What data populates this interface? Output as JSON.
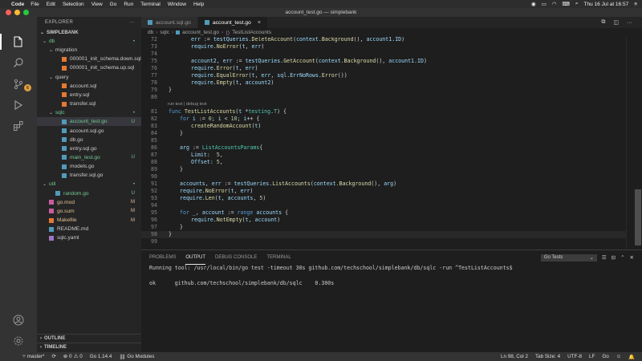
{
  "menubar": {
    "app": "Code",
    "items": [
      "File",
      "Edit",
      "Selection",
      "View",
      "Go",
      "Run",
      "Terminal",
      "Window",
      "Help"
    ],
    "datetime": "Thu 16 Jul at 16:57"
  },
  "window": {
    "title": "account_test.go — simplebank"
  },
  "sidebar": {
    "header": "EXPLORER",
    "project": "SIMPLEBANK",
    "tree": [
      {
        "label": "db",
        "depth": 0,
        "chev": "v",
        "type": "folder",
        "color": "green",
        "status": "•"
      },
      {
        "label": "migration",
        "depth": 1,
        "chev": "v",
        "type": "folder"
      },
      {
        "label": "000001_init_schema.down.sql",
        "depth": 2,
        "type": "sql"
      },
      {
        "label": "000001_init_schema.up.sql",
        "depth": 2,
        "type": "sql"
      },
      {
        "label": "query",
        "depth": 1,
        "chev": "v",
        "type": "folder"
      },
      {
        "label": "account.sql",
        "depth": 2,
        "type": "sql"
      },
      {
        "label": "entry.sql",
        "depth": 2,
        "type": "sql"
      },
      {
        "label": "transfer.sql",
        "depth": 2,
        "type": "sql"
      },
      {
        "label": "sqlc",
        "depth": 1,
        "chev": "v",
        "type": "folder",
        "color": "green",
        "status": "•"
      },
      {
        "label": "account_test.go",
        "depth": 2,
        "type": "go",
        "color": "green",
        "status": "U",
        "selected": true
      },
      {
        "label": "account.sql.go",
        "depth": 2,
        "type": "go"
      },
      {
        "label": "db.go",
        "depth": 2,
        "type": "go"
      },
      {
        "label": "entry.sql.go",
        "depth": 2,
        "type": "go"
      },
      {
        "label": "main_test.go",
        "depth": 2,
        "type": "go",
        "color": "green",
        "status": "U"
      },
      {
        "label": "models.go",
        "depth": 2,
        "type": "go"
      },
      {
        "label": "transfer.sql.go",
        "depth": 2,
        "type": "go"
      },
      {
        "label": "util",
        "depth": 0,
        "chev": "v",
        "type": "folder",
        "color": "green",
        "status": "•"
      },
      {
        "label": "random.go",
        "depth": 1,
        "type": "go",
        "color": "green",
        "status": "U"
      },
      {
        "label": "go.mod",
        "depth": 0,
        "type": "mod",
        "color": "orange",
        "status": "M"
      },
      {
        "label": "go.sum",
        "depth": 0,
        "type": "mod",
        "color": "orange",
        "status": "M"
      },
      {
        "label": "Makefile",
        "depth": 0,
        "type": "make",
        "color": "orange",
        "status": "M"
      },
      {
        "label": "README.md",
        "depth": 0,
        "type": "md"
      },
      {
        "label": "sqlc.yaml",
        "depth": 0,
        "type": "yaml"
      }
    ],
    "outline": "OUTLINE",
    "timeline": "TIMELINE"
  },
  "activity": {
    "badge": "6"
  },
  "tabs": [
    {
      "label": "account.sql.go",
      "active": false
    },
    {
      "label": "account_test.go",
      "active": true,
      "close": "×"
    }
  ],
  "breadcrumb": [
    "db",
    "sqlc",
    "account_test.go",
    "TestListAccounts"
  ],
  "editor": {
    "codelens": "run test | debug test",
    "lines": [
      {
        "n": "72",
        "html": "<span class='v'>err</span> := <span class='v'>testQueries</span>.<span class='f'>DeleteAccount</span>(<span class='v'>context</span>.<span class='f'>Background</span>(), <span class='v'>account1</span>.<span class='v'>ID</span>)",
        "indent": 2
      },
      {
        "n": "73",
        "html": "<span class='v'>require</span>.<span class='f'>NoError</span>(<span class='v'>t</span>, <span class='v'>err</span>)",
        "indent": 2
      },
      {
        "n": "74",
        "html": "",
        "indent": 0
      },
      {
        "n": "75",
        "html": "<span class='v'>account2</span>, <span class='v'>err</span> := <span class='v'>testQueries</span>.<span class='f'>GetAccount</span>(<span class='v'>context</span>.<span class='f'>Background</span>(), <span class='v'>account1</span>.<span class='v'>ID</span>)",
        "indent": 2
      },
      {
        "n": "76",
        "html": "<span class='v'>require</span>.<span class='f'>Error</span>(<span class='v'>t</span>, <span class='v'>err</span>)",
        "indent": 2
      },
      {
        "n": "77",
        "html": "<span class='v'>require</span>.<span class='f'>EqualError</span>(<span class='v'>t</span>, <span class='v'>err</span>, <span class='v'>sql</span>.<span class='v'>ErrNoRows</span>.<span class='f'>Error</span>())",
        "indent": 2
      },
      {
        "n": "78",
        "html": "<span class='v'>require</span>.<span class='f'>Empty</span>(<span class='v'>t</span>, <span class='v'>account2</span>)",
        "indent": 2
      },
      {
        "n": "79",
        "html": "}",
        "indent": 0
      },
      {
        "n": "80",
        "html": "",
        "indent": 0
      },
      {
        "n": "81",
        "html": "<span class='k'>func</span> <span class='f'>TestListAccounts</span>(<span class='v'>t</span> *<span class='t'>testing</span>.<span class='t'>T</span>) {",
        "indent": 0
      },
      {
        "n": "82",
        "html": "<span class='k'>for</span> <span class='v'>i</span> := <span class='n'>0</span>; <span class='v'>i</span> &lt; <span class='n'>10</span>; <span class='v'>i</span>++ {",
        "indent": 1
      },
      {
        "n": "83",
        "html": "<span class='f'>createRandomAccount</span>(<span class='v'>t</span>)",
        "indent": 2
      },
      {
        "n": "84",
        "html": "}",
        "indent": 1
      },
      {
        "n": "85",
        "html": "",
        "indent": 0
      },
      {
        "n": "86",
        "html": "<span class='v'>arg</span> := <span class='t'>ListAccountsParams</span>{",
        "indent": 1
      },
      {
        "n": "87",
        "html": "<span class='v'>Limit</span>:  <span class='n'>5</span>,",
        "indent": 2
      },
      {
        "n": "88",
        "html": "<span class='v'>Offset</span>: <span class='n'>5</span>,",
        "indent": 2
      },
      {
        "n": "89",
        "html": "}",
        "indent": 1
      },
      {
        "n": "90",
        "html": "",
        "indent": 0
      },
      {
        "n": "91",
        "html": "<span class='v'>accounts</span>, <span class='v'>err</span> := <span class='v'>testQueries</span>.<span class='f'>ListAccounts</span>(<span class='v'>context</span>.<span class='f'>Background</span>(), <span class='v'>arg</span>)",
        "indent": 1
      },
      {
        "n": "92",
        "html": "<span class='v'>require</span>.<span class='f'>NoError</span>(<span class='v'>t</span>, <span class='v'>err</span>)",
        "indent": 1
      },
      {
        "n": "93",
        "html": "<span class='v'>require</span>.<span class='f'>Len</span>(<span class='v'>t</span>, <span class='v'>accounts</span>, <span class='n'>5</span>)",
        "indent": 1
      },
      {
        "n": "94",
        "html": "",
        "indent": 0
      },
      {
        "n": "95",
        "html": "<span class='k'>for</span> <span class='v'>_</span>, <span class='v'>account</span> := <span class='k'>range</span> <span class='v'>accounts</span> {",
        "indent": 1
      },
      {
        "n": "96",
        "html": "<span class='v'>require</span>.<span class='f'>NotEmpty</span>(<span class='v'>t</span>, <span class='v'>account</span>)",
        "indent": 2
      },
      {
        "n": "97",
        "html": "}",
        "indent": 1
      },
      {
        "n": "98",
        "html": "}",
        "indent": 0,
        "cursor": true
      },
      {
        "n": "99",
        "html": "",
        "indent": 0
      }
    ]
  },
  "panel": {
    "tabs": [
      "PROBLEMS",
      "OUTPUT",
      "DEBUG CONSOLE",
      "TERMINAL"
    ],
    "active_tab": "OUTPUT",
    "dropdown": "Go Tests",
    "output": [
      "Running tool: /usr/local/bin/go test -timeout 30s github.com/techschool/simplebank/db/sqlc -run ^TestListAccounts$",
      "",
      "ok      github.com/techschool/simplebank/db/sqlc    0.300s"
    ]
  },
  "statusbar": {
    "branch": "master*",
    "errors": "0",
    "warnings": "0",
    "go_version": "Go 1.14.4",
    "go_modules": "Go Modules",
    "position": "Ln 98, Col 2",
    "tab_size": "Tab Size: 4",
    "encoding": "UTF-8",
    "eol": "LF",
    "language": "Go"
  },
  "colors": {
    "accent_green": "#73c991",
    "modified_orange": "#e2c08d",
    "sql_icon": "#e37933",
    "go_icon": "#519aba"
  }
}
